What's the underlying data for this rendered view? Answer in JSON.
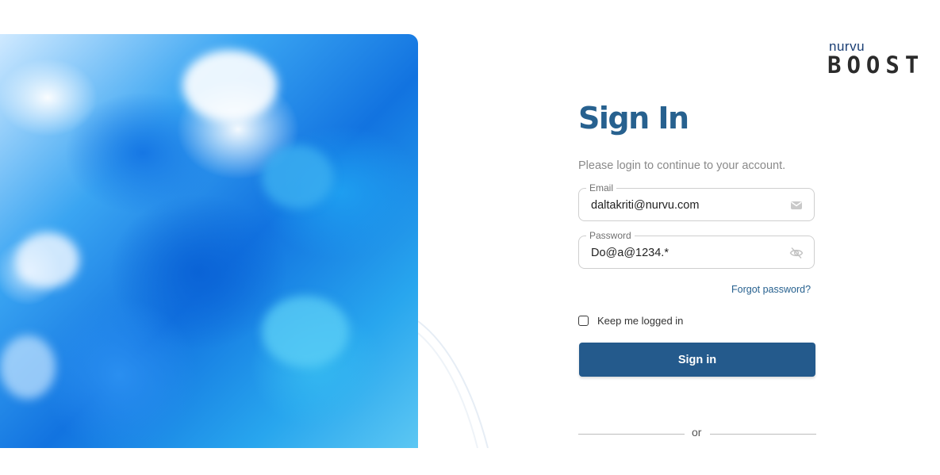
{
  "brand": {
    "small": "nurvu",
    "big": "BOOST"
  },
  "login": {
    "title": "Sign In",
    "subtitle": "Please login to continue to your account.",
    "email": {
      "label": "Email",
      "value": "daltakriti@nurvu.com",
      "icon": "envelope-icon"
    },
    "password": {
      "label": "Password",
      "value": "Do@a@1234.*",
      "icon": "eye-slash-icon"
    },
    "forgot_link": "Forgot password?",
    "remember_label": "Keep me logged in",
    "remember_checked": false,
    "submit_label": "Sign in",
    "divider_text": "or"
  },
  "colors": {
    "primary": "#245a8c",
    "title": "#27618f",
    "hero_blue": "#1677e4"
  }
}
